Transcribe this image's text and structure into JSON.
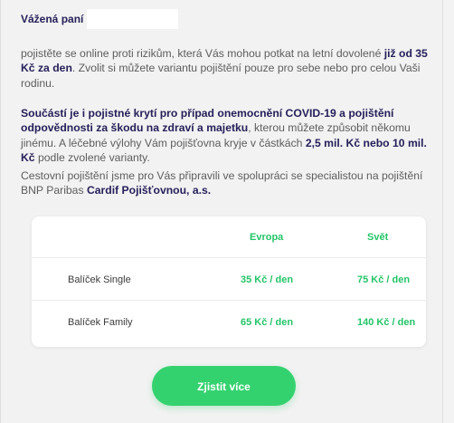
{
  "email": {
    "greeting": "Vážená paní",
    "paragraph_1": {
      "text_1": "pojistěte se online proti rizikům, která Vás mohou potkat na letní dovolené ",
      "strong_1": "již od 35 Kč za den",
      "text_2": ". Zvolit si můžete variantu pojištění pouze pro sebe nebo pro celou Vaši rodinu."
    },
    "paragraph_2": {
      "strong_1": "Součástí je i pojistné krytí pro případ onemocnění COVID-19 a pojištění odpovědnosti za škodu na zdraví a majetku",
      "text_1": ", kterou můžete způsobit někomu jinému. A léčebné výlohy Vám pojišťovna kryje v částkách ",
      "strong_2": "2,5 mil. Kč nebo 10 mil. Kč",
      "text_2": " podle zvolené varianty."
    },
    "paragraph_3": {
      "text_1": "Cestovní pojištění jsme pro Vás připravili ve spolupráci se specialistou na pojištění BNP Paribas ",
      "strong_1": "Cardif Pojišťovnou, a.s."
    }
  },
  "pricing": {
    "headers": {
      "europe": "Evropa",
      "world": "Svět"
    },
    "rows": [
      {
        "label": "Balíček Single",
        "europe": "35 Kč / den",
        "world": "75 Kč / den"
      },
      {
        "label": "Balíček Family",
        "europe": "65 Kč / den",
        "world": "140 Kč / den"
      }
    ]
  },
  "cta": {
    "label": "Zjistit více"
  },
  "colors": {
    "accent": "#24c468",
    "brand_dark": "#26205a",
    "button": "#34d26f"
  }
}
